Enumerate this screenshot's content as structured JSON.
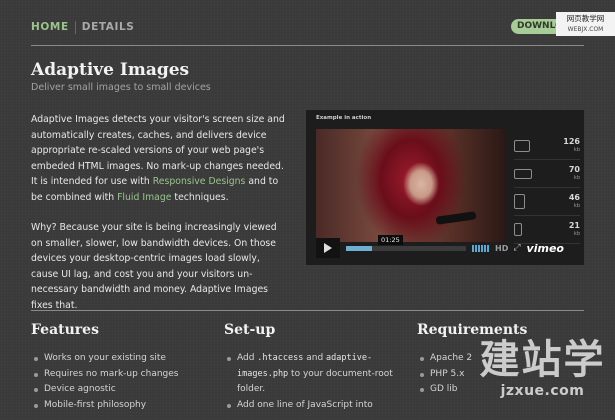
{
  "nav": {
    "home_label": "HOME",
    "details_label": "DETAILS",
    "download_label": "DOWNLOAD"
  },
  "watermark_top": {
    "line1": "网页教学网",
    "line2": "WEBJX.COM"
  },
  "header": {
    "title": "Adaptive Images",
    "subtitle": "Deliver small images to small devices"
  },
  "intro": {
    "p1_part1": "Adaptive Images detects your visitor's screen size and automatically creates, caches, and delivers device appropriate re-scaled versions of your web page's embeded HTML images. No mark-up changes needed. It is intended for use with ",
    "p1_link1": "Responsive Designs",
    "p1_part2": " and to be combined with ",
    "p1_link2": "Fluid Image",
    "p1_part3": " techniques.",
    "p2": "Why? Because your site is being increasingly viewed on smaller, slower, low bandwidth devices. On those devices your desktop-centric images load slowly, cause UI lag, and cost you and your visitors un-necessary bandwidth and money. Adaptive Images fixes that."
  },
  "video": {
    "label": "Example in action",
    "timecode": "01:25",
    "progress": 0.22,
    "hd_label": "HD",
    "brand": "vimeo",
    "devices": [
      {
        "icon": "monitor-icon",
        "size": "126",
        "unit": "kb"
      },
      {
        "icon": "laptop-icon",
        "size": "70",
        "unit": "kb"
      },
      {
        "icon": "tablet-icon",
        "size": "46",
        "unit": "kb"
      },
      {
        "icon": "phone-icon",
        "size": "21",
        "unit": "kb"
      }
    ],
    "colors": {
      "progress": "#6fb0d2",
      "background": "#1d1d1d"
    }
  },
  "features": {
    "heading": "Features",
    "items": [
      "Works on your existing site",
      "Requires no mark-up changes",
      "Device agnostic",
      "Mobile-first philosophy"
    ]
  },
  "setup": {
    "heading": "Set-up",
    "item1_a": "Add ",
    "item1_code1": ".htaccess",
    "item1_b": " and ",
    "item1_code2": "adaptive-images.php",
    "item1_c": " to your document-root folder.",
    "item2": "Add one line of JavaScript into"
  },
  "requirements": {
    "heading": "Requirements",
    "items": [
      "Apache 2",
      "PHP 5.x",
      "GD lib"
    ]
  },
  "watermark_bottom": {
    "text": "建站学",
    "domain": "jzxue.com"
  },
  "colors": {
    "accent": "#9ac38d",
    "background": "#3a3a3a",
    "download_button": "#a7cc96"
  }
}
